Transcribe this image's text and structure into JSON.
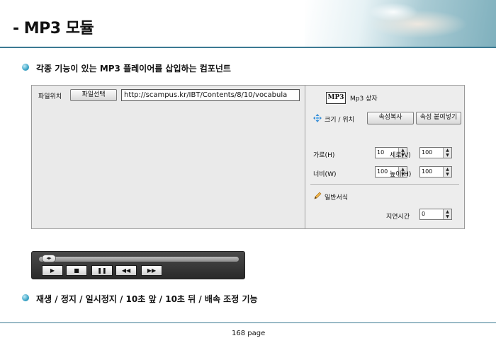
{
  "header": {
    "title": "- MP3 모듈"
  },
  "bullets": {
    "first": "각종 기능이 있는 MP3 플레이어를 삽입하는 컴포넌트",
    "second": "재생 / 정지 / 일시정지 / 10초 앞 / 10초 뒤 / 배속 조정 기능"
  },
  "file_row": {
    "label": "파일위치",
    "select_button": "파일선택",
    "url_value": "http://scampus.kr/IBT/Contents/8/10/vocabula"
  },
  "properties": {
    "component_icon": "MP3",
    "component_name": "Mp3 상자",
    "size_position_label": "크기 / 위치",
    "copy_button": "속성복사",
    "paste_button": "속성 붙여넣기",
    "fields": {
      "x_label": "가로(H)",
      "x_value": "10",
      "y_label": "세로(V)",
      "y_value": "100",
      "width_label": "너비(W)",
      "width_value": "100",
      "height_label": "높이(H)",
      "height_value": "100"
    },
    "general_label": "일반서식",
    "delay_label": "지연시간",
    "delay_value": "0"
  },
  "player": {
    "progress": 0.0,
    "buttons": [
      "▶",
      "■",
      "❚❚",
      "◀◀",
      "▶▶"
    ]
  },
  "footer": {
    "page": "168 page"
  },
  "colors": {
    "accent": "#3c7a93",
    "bullet": "#3aa4c7"
  },
  "icons": [
    "move-icon",
    "pencil-icon"
  ]
}
